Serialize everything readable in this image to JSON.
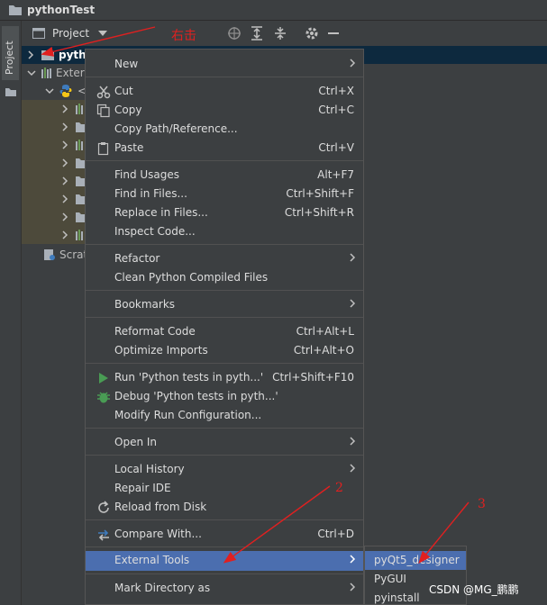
{
  "window": {
    "title": "pythonTest"
  },
  "sidebar": {
    "project_tab": "Project"
  },
  "panel": {
    "selector_label": "Project"
  },
  "tree": {
    "root_label": "pyth",
    "external_label": "Exter",
    "scratches_label": "Scrat",
    "python_label": "<"
  },
  "context_menu": {
    "new": "New",
    "cut": "Cut",
    "cut_shortcut": "Ctrl+X",
    "copy": "Copy",
    "copy_shortcut": "Ctrl+C",
    "copy_path": "Copy Path/Reference...",
    "paste": "Paste",
    "paste_shortcut": "Ctrl+V",
    "find_usages": "Find Usages",
    "find_usages_shortcut": "Alt+F7",
    "find_in_files": "Find in Files...",
    "find_in_files_shortcut": "Ctrl+Shift+F",
    "replace_in_files": "Replace in Files...",
    "replace_in_files_shortcut": "Ctrl+Shift+R",
    "inspect_code": "Inspect Code...",
    "refactor": "Refactor",
    "clean_compiled": "Clean Python Compiled Files",
    "bookmarks": "Bookmarks",
    "reformat_code": "Reformat Code",
    "reformat_code_shortcut": "Ctrl+Alt+L",
    "optimize_imports": "Optimize Imports",
    "optimize_imports_shortcut": "Ctrl+Alt+O",
    "run": "Run 'Python tests in pyth...'",
    "run_shortcut": "Ctrl+Shift+F10",
    "debug": "Debug 'Python tests in pyth...'",
    "modify_run": "Modify Run Configuration...",
    "open_in": "Open In",
    "local_history": "Local History",
    "repair_ide": "Repair IDE",
    "reload_disk": "Reload from Disk",
    "compare_with": "Compare With...",
    "compare_with_shortcut": "Ctrl+D",
    "external_tools": "External Tools",
    "mark_directory": "Mark Directory as"
  },
  "submenu": {
    "items": [
      "pyQt5_designer",
      "PyGUI",
      "pyinstall"
    ]
  },
  "annotations": {
    "right_click": "右击",
    "step2": "2",
    "step3": "3"
  },
  "watermark": "CSDN @MG_鹏鹏",
  "colors": {
    "menu_bg": "#3c3f41",
    "highlight": "#4b6eaf",
    "annotation": "#e02020"
  }
}
